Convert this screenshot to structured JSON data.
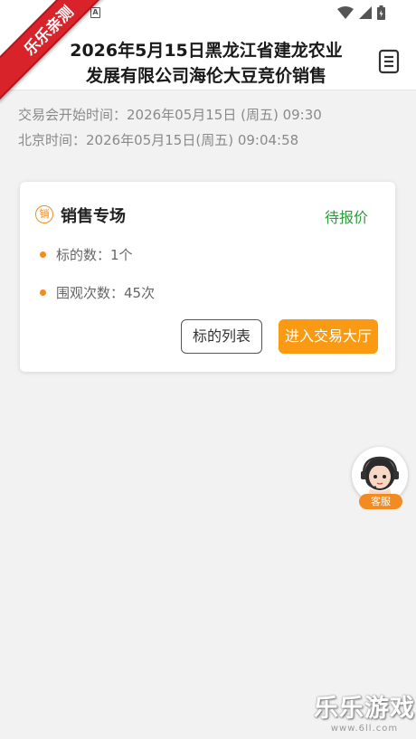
{
  "ribbon": {
    "label": "乐乐亲测"
  },
  "status_bar": {
    "app_icon": "A"
  },
  "nav": {
    "title": "2026年5月15日黑龙江省建龙农业发展有限公司海伦大豆竞价销售",
    "back_icon": "chevron-left-icon",
    "doc_icon": "document-icon"
  },
  "info": {
    "start_time": "交易会开始时间：2026年05月15日 (周五) 09:30",
    "beijing_time": "北京时间：2026年05月15日(周五) 09:04:58"
  },
  "card": {
    "badge": "销",
    "title": "销售专场",
    "status": "待报价",
    "status_color": "#2e9a3c",
    "lot_count": "标的数：1个",
    "view_count": "围观次数：45次",
    "list_button": "标的列表",
    "enter_button": "进入交易大厅",
    "accent_color": "#fa9a12"
  },
  "customer_service": {
    "label": "客服"
  },
  "watermark": {
    "title": "乐乐游戏",
    "url": "www.6ll.com"
  }
}
